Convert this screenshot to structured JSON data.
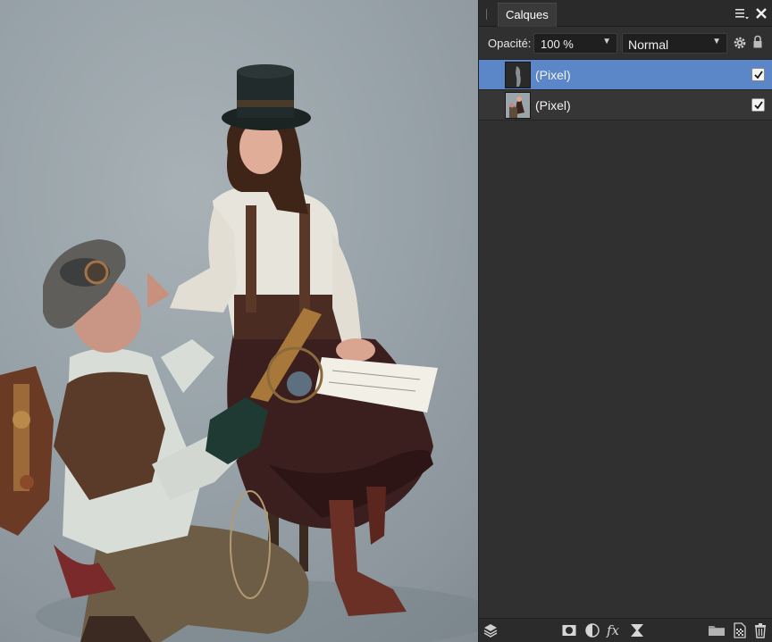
{
  "panel": {
    "tab_label": "Calques",
    "opacity_label": "Opacité:",
    "opacity_value": "100 %",
    "blend_mode": "Normal"
  },
  "layers": [
    {
      "label": "(Pixel)",
      "visible": true,
      "selected": true
    },
    {
      "label": "(Pixel)",
      "visible": true,
      "selected": false
    }
  ],
  "icons": {
    "tabbar": [
      "panel-grip-icon",
      "panel-menu-icon",
      "close-icon"
    ],
    "options": [
      "gear-icon",
      "lock-icon"
    ],
    "bottombar": [
      "layers-stack-icon",
      "mask-icon",
      "adjustment-icon",
      "fx-icon",
      "live-filter-icon",
      "folder-icon",
      "add-pixel-layer-icon",
      "trash-icon"
    ]
  },
  "colors": {
    "panel_bg": "#303030",
    "selection": "#5b87c9",
    "canvas_backdrop": "#98a3a9"
  }
}
